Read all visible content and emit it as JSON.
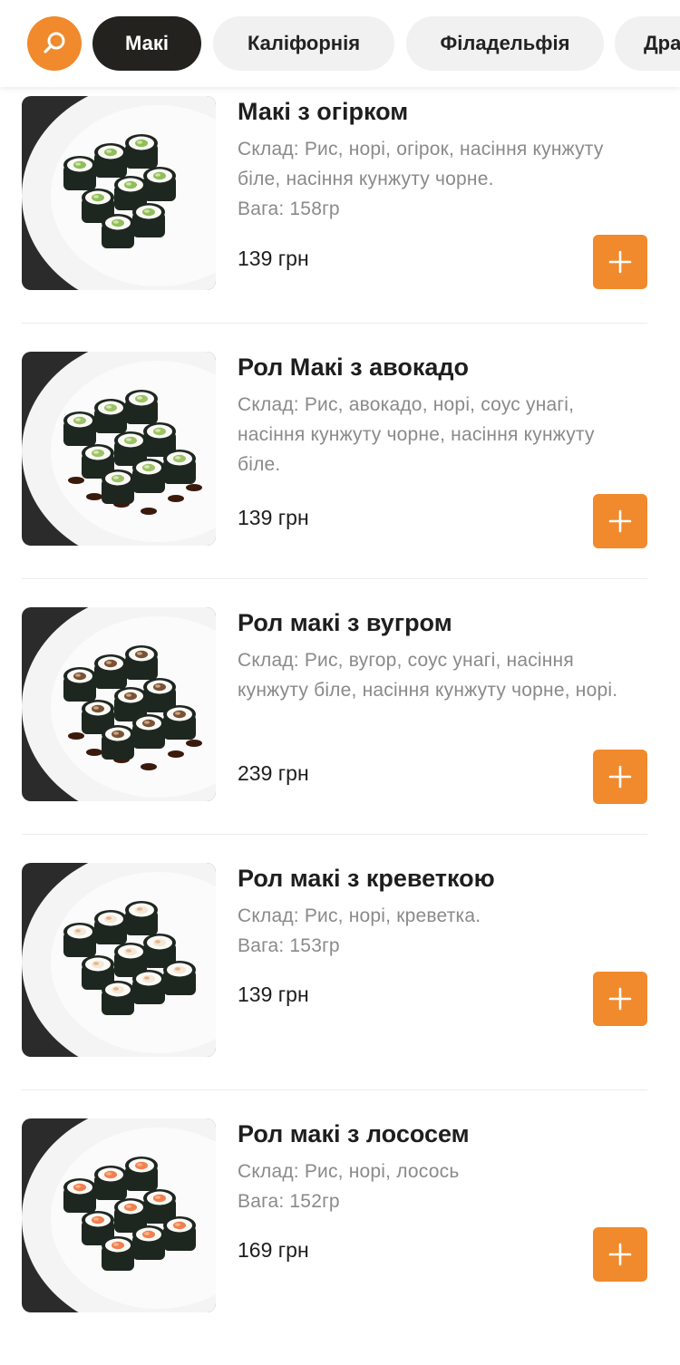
{
  "colors": {
    "accent": "#f08a2d",
    "active_tab": "#23221f"
  },
  "header": {
    "search_icon": "search-icon",
    "tabs": [
      {
        "label": "Макі",
        "active": true
      },
      {
        "label": "Каліфорнія",
        "active": false
      },
      {
        "label": "Філадельфія",
        "active": false
      },
      {
        "label": "Дра",
        "active": false
      }
    ]
  },
  "products": [
    {
      "name": "Макі з огірком",
      "desc": "Склад: Рис, норі, огірок, насіння кунжуту біле, насіння кунжуту чорне.",
      "weight": "Вага: 158гр",
      "price": "139 грн",
      "topping": "cucumber"
    },
    {
      "name": "Рол Макі з авокадо",
      "desc": "Склад: Рис, авокадо, норі, соус унагі, насіння кунжуту чорне, насіння кунжуту біле.",
      "weight": "",
      "price": "139 грн",
      "topping": "avocado"
    },
    {
      "name": "Рол макі з вугром",
      "desc": "Склад: Рис, вугор, соус унагі, насіння кунжуту біле, насіння кунжуту чорне, норі.",
      "weight": "",
      "price": "239 грн",
      "topping": "eel"
    },
    {
      "name": "Рол макі з креветкою",
      "desc": "Склад: Рис, норі, креветка.",
      "weight": "Вага: 153гр",
      "price": "139 грн",
      "topping": "shrimp"
    },
    {
      "name": "Рол макі з лососем",
      "desc": "Склад: Рис, норі, лосось",
      "weight": "Вага: 152гр",
      "price": "169 грн",
      "topping": "salmon"
    }
  ]
}
